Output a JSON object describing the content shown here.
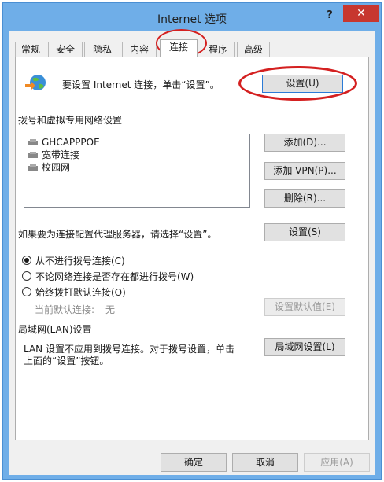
{
  "window": {
    "title": "Internet 选项",
    "help": "?",
    "close": "✕"
  },
  "tabs": [
    "常规",
    "安全",
    "隐私",
    "内容",
    "连接",
    "程序",
    "高级"
  ],
  "setup": {
    "text": "要设置 Internet 连接，单击“设置”。",
    "button": "设置(U)"
  },
  "dialup": {
    "section_title": "拨号和虚拟专用网络设置",
    "connections": [
      "GHCAPPPOE",
      "宽带连接",
      "校园网"
    ],
    "add": "添加(D)...",
    "add_vpn": "添加 VPN(P)...",
    "delete": "删除(R)...",
    "proxy_text": "如果要为连接配置代理服务器，请选择“设置”。",
    "settings": "设置(S)",
    "options": [
      "从不进行拨号连接(C)",
      "不论网络连接是否存在都进行拨号(W)",
      "始终拨打默认连接(O)"
    ],
    "selected_option": 0,
    "current_default_label": "当前默认连接:",
    "current_default_value": "无",
    "set_default": "设置默认值(E)"
  },
  "lan": {
    "section_title": "局域网(LAN)设置",
    "text_line1": "LAN 设置不应用到拨号连接。对于拨号设置，单击",
    "text_line2": "上面的“设置”按钮。",
    "button": "局域网设置(L)"
  },
  "footer": {
    "ok": "确定",
    "cancel": "取消",
    "apply": "应用(A)"
  },
  "colors": {
    "frame": "#6faee8",
    "close": "#c7372f",
    "highlight": "#d42020"
  }
}
